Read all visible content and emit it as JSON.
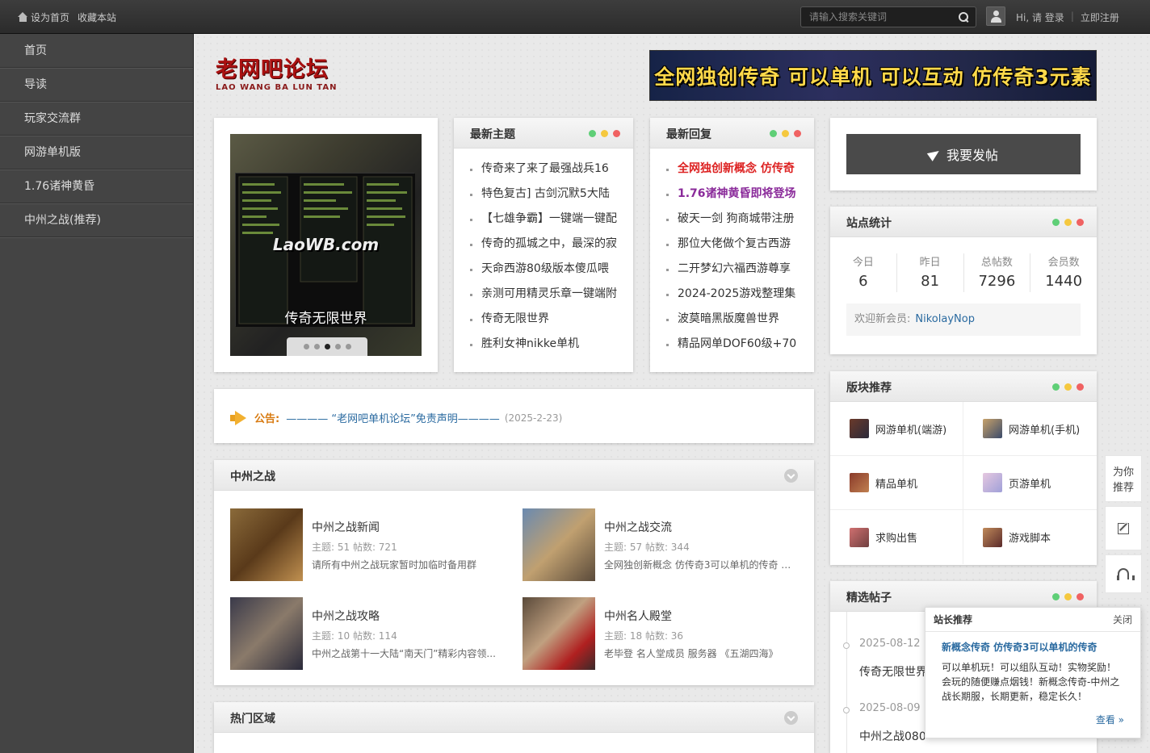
{
  "topbar": {
    "set_home": "设为首页",
    "favorite": "收藏本站",
    "search_placeholder": "请输入搜索关键词",
    "greeting": "Hi, 请 登录",
    "register": "立即注册"
  },
  "sidebar": {
    "items": [
      "首页",
      "导读",
      "玩家交流群",
      "网游单机版",
      "1.76诸神黄昏",
      "中州之战(推荐)"
    ]
  },
  "logo": {
    "title": "老网吧论坛",
    "subtitle": "LAO WANG BA LUN TAN"
  },
  "banner": {
    "text": "全网独创传奇 可以单机 可以互动 仿传奇3元素"
  },
  "slider": {
    "watermark": "LaoWB.com",
    "caption": "传奇无限世界",
    "active_dot": 3
  },
  "latest_topics": {
    "title": "最新主题",
    "items": [
      "传奇来了来了最强战兵16",
      "特色复古] 古剑沉默5大陆",
      "【七雄争霸】一键端一键配",
      "传奇的孤城之中，最深的寂",
      "天命西游80级版本傻瓜喂",
      "亲测可用精灵乐章一键端附",
      "传奇无限世界",
      "胜利女神nikke单机"
    ]
  },
  "latest_replies": {
    "title": "最新回复",
    "items": [
      "全网独创新概念 仿传奇",
      "1.76诸神黄昏即将登场",
      "破天一剑 狗商城带注册",
      "那位大佬做个复古西游",
      "二开梦幻六福西游尊享",
      "2024-2025游戏整理集",
      "波莫暗黑版魔兽世界",
      "精品网单DOF60级+70"
    ]
  },
  "post_button": {
    "label": "我要发帖"
  },
  "site_stats": {
    "title": "站点统计",
    "stats": [
      {
        "label": "今日",
        "value": "6"
      },
      {
        "label": "昨日",
        "value": "81"
      },
      {
        "label": "总帖数",
        "value": "7296"
      },
      {
        "label": "会员数",
        "value": "1440"
      }
    ],
    "welcome_label": "欢迎新会员:",
    "new_member": "NikolayNop"
  },
  "recommended_boards": {
    "title": "版块推荐",
    "items": [
      "网游单机(端游)",
      "网游单机(手机)",
      "精品单机",
      "页游单机",
      "求购出售",
      "游戏脚本"
    ]
  },
  "notice": {
    "label": "公告:",
    "text": "———— “老网吧单机论坛”免责声明————",
    "date": "(2025-2-23)"
  },
  "zhongzhou": {
    "title": "中州之战",
    "forums": [
      {
        "name": "中州之战新闻",
        "stats": "主题: 51   帖数: 721",
        "desc": "请所有中州之战玩家暂时加临时备用群"
      },
      {
        "name": "中州之战交流",
        "stats": "主题: 57   帖数: 344",
        "desc": "全网独创新概念 仿传奇3可以单机的传奇 可..."
      },
      {
        "name": "中州之战攻略",
        "stats": "主题: 10   帖数: 114",
        "desc": "中州之战第十一大陆“南天门”精彩内容领..."
      },
      {
        "name": "中州名人殿堂",
        "stats": "主题: 18   帖数: 36",
        "desc": "老毕登 名人堂成员 服务器 《五湖四海》"
      }
    ]
  },
  "hot_zone": {
    "title": "热门区域"
  },
  "featured": {
    "title": "精选帖子",
    "items": [
      {
        "date": "2025-08-12",
        "title": "传奇无限世界"
      },
      {
        "date": "2025-08-09",
        "title": "中州之战080"
      }
    ]
  },
  "float_bar": {
    "recommend": "为你推荐"
  },
  "popup": {
    "header": "站长推荐",
    "close": "关闭",
    "title": "新概念传奇 仿传奇3可以单机的传奇",
    "body": "可以单机玩！可以组队互动！实物奖励！会玩的随便赚点烟钱！新概念传奇-中州之战长期服，长期更新，稳定长久！",
    "more": "查看 »"
  },
  "colors": {
    "accent_red": "#d22222",
    "accent_purple": "#8a2a9a",
    "link_blue": "#2a6aa0",
    "dot_green": "#5fcf77",
    "dot_yellow": "#f5c83f",
    "dot_red": "#f06262"
  }
}
